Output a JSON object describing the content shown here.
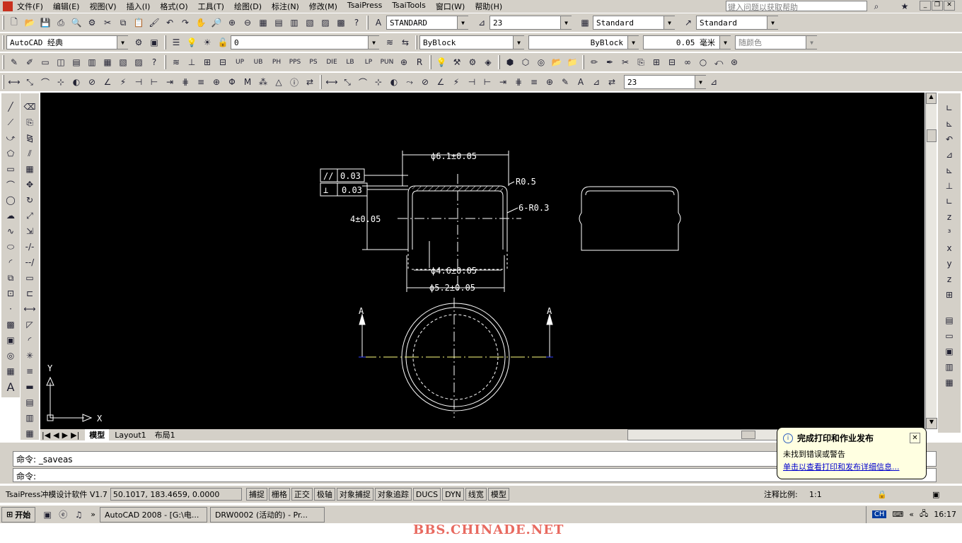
{
  "menubar": {
    "items": [
      "文件(F)",
      "编辑(E)",
      "视图(V)",
      "插入(I)",
      "格式(O)",
      "工具(T)",
      "绘图(D)",
      "标注(N)",
      "修改(M)",
      "TsaiPress",
      "TsaiTools",
      "窗口(W)",
      "帮助(H)"
    ],
    "help_search_placeholder": "键入问题以获取帮助"
  },
  "toolbar1": {
    "text_style": "STANDARD",
    "dim_value": "23",
    "table_style": "Standard",
    "mleader_style": "Standard"
  },
  "toolbar2": {
    "workspace": "AutoCAD 经典",
    "layer": "0",
    "color": "ByBlock",
    "linetype": "ByBlock",
    "lineweight": "0.05 毫米",
    "plotstyle": "随颜色"
  },
  "toolbar3": {
    "labels": [
      "UP",
      "UB",
      "PH",
      "PPS",
      "PS",
      "DIE",
      "LB",
      "LP",
      "PUN"
    ]
  },
  "toolbar4": {
    "dim_combo": "23"
  },
  "drawing": {
    "dim_top": "ϕ6.1±0.05",
    "flatness": "0.03",
    "perp": "0.03",
    "r1": "R0.5",
    "r2": "6-R0.3",
    "height": "4±0.05",
    "dim_inner": "ϕ4.6±0.05",
    "dim_bottom": "ϕ5.2±0.05",
    "section_a": "A",
    "axis_x": "X",
    "axis_y": "Y",
    "colors": {
      "bg": "#000000",
      "line": "#ffffff",
      "center": "#ffffff",
      "dim": "#ffffff"
    }
  },
  "tabs": {
    "items": [
      "模型",
      "Layout1",
      "布局1"
    ]
  },
  "command": {
    "line1": "命令:  _saveas",
    "line2": "命令:"
  },
  "balloon": {
    "title": "完成打印和作业发布",
    "body": "未找到错误或警告",
    "link": "单击以查看打印和发布详细信息..."
  },
  "status": {
    "app": "TsaiPress冲模设计软件 V1.7",
    "coords": "50.1017,  183.4659,  0.0000",
    "toggles": [
      "捕捉",
      "栅格",
      "正交",
      "极轴",
      "对象捕捉",
      "对象追踪",
      "DUCS",
      "DYN",
      "线宽",
      "模型"
    ],
    "annotation_scale_label": "注释比例:",
    "annotation_scale": "1:1"
  },
  "taskbar": {
    "start": "开始",
    "tasks": [
      "AutoCAD 2008 - [G:\\电...",
      "DRW0002 (活动的) - Pr..."
    ],
    "lang": "CH",
    "clock": "16:17"
  },
  "watermark": "BBS.CHINADE.NET"
}
